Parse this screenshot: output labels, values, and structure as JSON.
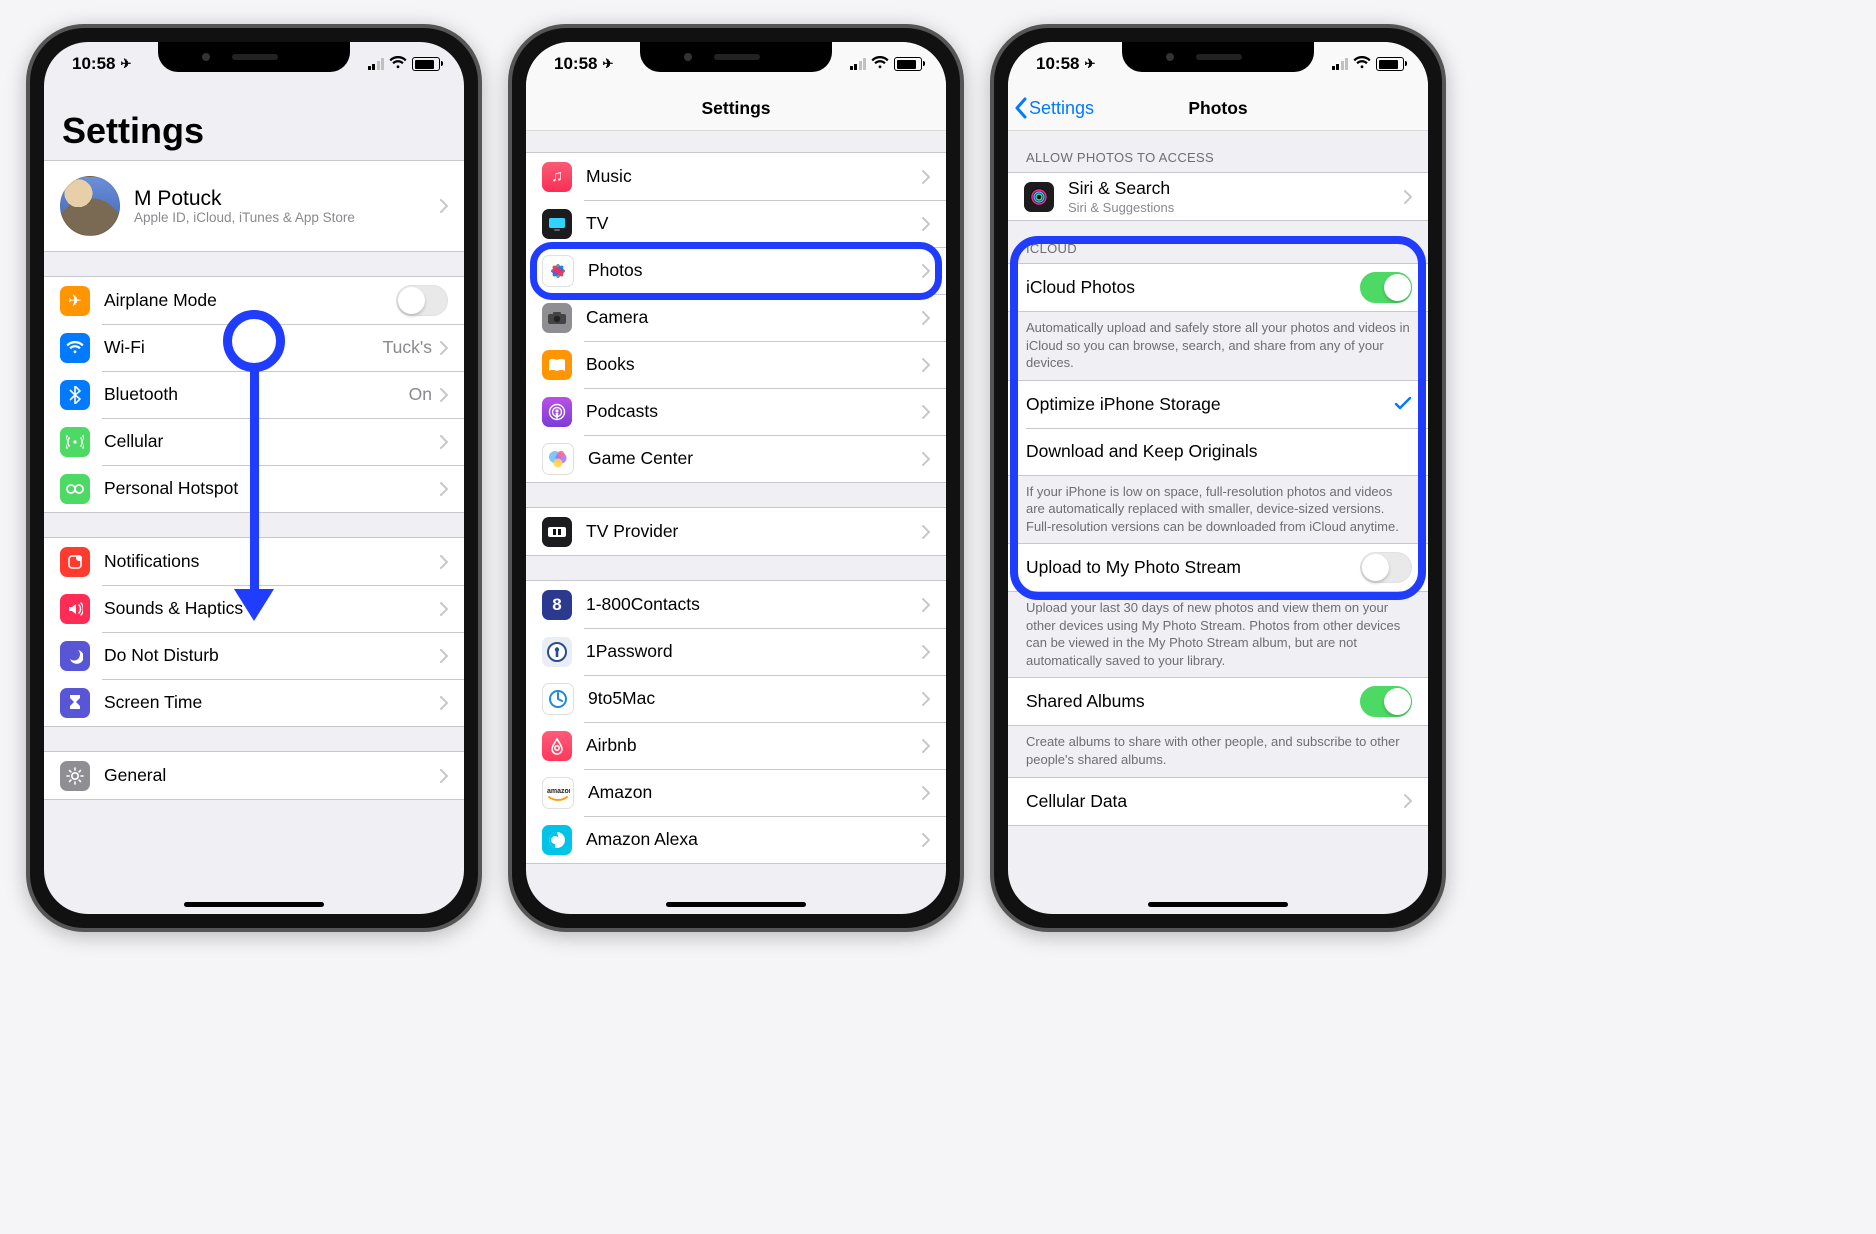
{
  "status": {
    "time": "10:58",
    "location_glyph": "➤"
  },
  "screen1": {
    "title": "Settings",
    "apple_id": {
      "name": "M Potuck",
      "subtitle": "Apple ID, iCloud, iTunes & App Store"
    },
    "rows": {
      "airplane": "Airplane Mode",
      "wifi": "Wi-Fi",
      "wifi_detail": "Tuck's",
      "bt": "Bluetooth",
      "bt_detail": "On",
      "cell": "Cellular",
      "hotspot": "Personal Hotspot",
      "notif": "Notifications",
      "sounds": "Sounds & Haptics",
      "dnd": "Do Not Disturb",
      "screentime": "Screen Time",
      "general": "General"
    }
  },
  "screen2": {
    "title": "Settings",
    "items": [
      {
        "key": "music",
        "label": "Music"
      },
      {
        "key": "tv",
        "label": "TV"
      },
      {
        "key": "photos",
        "label": "Photos"
      },
      {
        "key": "camera",
        "label": "Camera"
      },
      {
        "key": "books",
        "label": "Books"
      },
      {
        "key": "podcasts",
        "label": "Podcasts"
      },
      {
        "key": "gamecenter",
        "label": "Game Center"
      }
    ],
    "items2": [
      {
        "key": "tvprovider",
        "label": "TV Provider"
      }
    ],
    "apps": [
      {
        "key": "1800",
        "label": "1-800Contacts"
      },
      {
        "key": "1pw",
        "label": "1Password"
      },
      {
        "key": "9to5",
        "label": "9to5Mac"
      },
      {
        "key": "airbnb",
        "label": "Airbnb"
      },
      {
        "key": "amazon",
        "label": "Amazon"
      },
      {
        "key": "alexa",
        "label": "Amazon Alexa"
      }
    ]
  },
  "screen3": {
    "back": "Settings",
    "title": "Photos",
    "allow_header": "ALLOW PHOTOS TO ACCESS",
    "siri_title": "Siri & Search",
    "siri_sub": "Siri & Suggestions",
    "icloud_header": "ICLOUD",
    "icloud_photos": "iCloud Photos",
    "icloud_desc": "Automatically upload and safely store all your photos and videos in iCloud so you can browse, search, and share from any of your devices.",
    "optimize": "Optimize iPhone Storage",
    "download": "Download and Keep Originals",
    "storage_desc": "If your iPhone is low on space, full-resolution photos and videos are automatically replaced with smaller, device-sized versions. Full-resolution versions can be downloaded from iCloud anytime.",
    "upload_stream": "Upload to My Photo Stream",
    "upload_desc": "Upload your last 30 days of new photos and view them on your other devices using My Photo Stream. Photos from other devices can be viewed in the My Photo Stream album, but are not automatically saved to your library.",
    "shared": "Shared Albums",
    "shared_desc": "Create albums to share with other people, and subscribe to other people's shared albums.",
    "cellular": "Cellular Data"
  }
}
